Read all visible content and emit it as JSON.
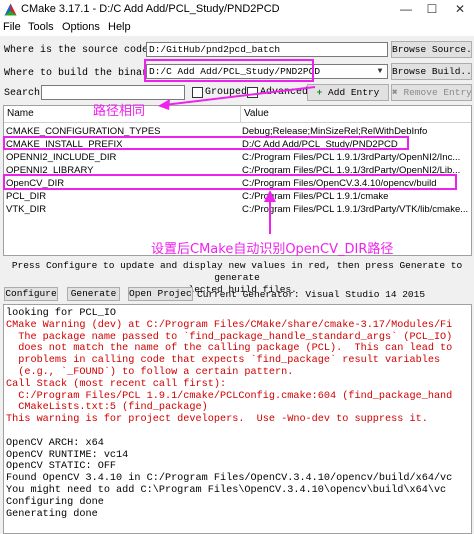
{
  "window": {
    "title": "CMake 3.17.1 - D:/C Add Add/PCL_Study/PND2PCD",
    "minimize_glyph": "—",
    "maximize_glyph": "☐",
    "close_glyph": "✕"
  },
  "menu": [
    "File",
    "Tools",
    "Options",
    "Help"
  ],
  "paths": {
    "source_label": "Where is the source code:",
    "source_value": "D:/GitHub/pnd2pcd_batch",
    "source_button": "Browse Source...",
    "build_label": "Where to build the binaries:",
    "build_value": "D:/C Add Add/PCL_Study/PND2PCD",
    "build_button": "Browse Build..."
  },
  "search": {
    "label": "Search:",
    "value": "",
    "grouped_label": "Grouped",
    "advanced_label": "Advanced",
    "add_entry": "Add Entry",
    "remove_entry": "Remove Entry"
  },
  "table": {
    "columns": [
      "Name",
      "Value"
    ],
    "rows": [
      {
        "name": "CMAKE_CONFIGURATION_TYPES",
        "value": "Debug;Release;MinSizeRel;RelWithDebInfo"
      },
      {
        "name": "CMAKE_INSTALL_PREFIX",
        "value": "D:/C Add Add/PCL_Study/PND2PCD"
      },
      {
        "name": "OPENNI2_INCLUDE_DIR",
        "value": "C:/Program Files/PCL 1.9.1/3rdParty/OpenNI2/Inc..."
      },
      {
        "name": "OPENNI2_LIBRARY",
        "value": "C:/Program Files/PCL 1.9.1/3rdParty/OpenNI2/Lib..."
      },
      {
        "name": "OpenCV_DIR",
        "value": "C:/Program Files/OpenCV.3.4.10/opencv/build"
      },
      {
        "name": "PCL_DIR",
        "value": "C:/Program Files/PCL 1.9.1/cmake"
      },
      {
        "name": "VTK_DIR",
        "value": "C:/Program Files/PCL 1.9.1/3rdParty/VTK/lib/cmake..."
      }
    ]
  },
  "annotations": {
    "same_path": "路径相同",
    "opencv_auto": "设置后CMake自动识别OpenCV_DIR路径",
    "color": "#ee22ee"
  },
  "info_text_1": "Press Configure to update and display new values in red, then press Generate to generate",
  "info_text_2": "selected build files.",
  "actions": {
    "configure": "Configure",
    "generate": "Generate",
    "open_project": "Open Project",
    "generator": "Current Generator: Visual Studio 14 2015"
  },
  "console": [
    {
      "text": "looking for PCL_IO",
      "red": false
    },
    {
      "text": "CMake Warning (dev) at C:/Program Files/CMake/share/cmake-3.17/Modules/Fi",
      "red": true
    },
    {
      "text": "  The package name passed to `find_package_handle_standard_args` (PCL_IO)",
      "red": true
    },
    {
      "text": "  does not match the name of the calling package (PCL).  This can lead to",
      "red": true
    },
    {
      "text": "  problems in calling code that expects `find_package` result variables",
      "red": true
    },
    {
      "text": "  (e.g., `_FOUND`) to follow a certain pattern.",
      "red": true
    },
    {
      "text": "Call Stack (most recent call first):",
      "red": true
    },
    {
      "text": "  C:/Program Files/PCL 1.9.1/cmake/PCLConfig.cmake:604 (find_package_hand",
      "red": true
    },
    {
      "text": "  CMakeLists.txt:5 (find_package)",
      "red": true
    },
    {
      "text": "This warning is for project developers.  Use -Wno-dev to suppress it.",
      "red": true
    },
    {
      "text": "",
      "red": false
    },
    {
      "text": "OpenCV ARCH: x64",
      "red": false
    },
    {
      "text": "OpenCV RUNTIME: vc14",
      "red": false
    },
    {
      "text": "OpenCV STATIC: OFF",
      "red": false
    },
    {
      "text": "Found OpenCV 3.4.10 in C:/Program Files/OpenCV.3.4.10/opencv/build/x64/vc",
      "red": false
    },
    {
      "text": "You might need to add C:\\Program Files\\OpenCV.3.4.10\\opencv\\build\\x64\\vc",
      "red": false
    },
    {
      "text": "Configuring done",
      "red": false
    },
    {
      "text": "Generating done",
      "red": false
    }
  ]
}
